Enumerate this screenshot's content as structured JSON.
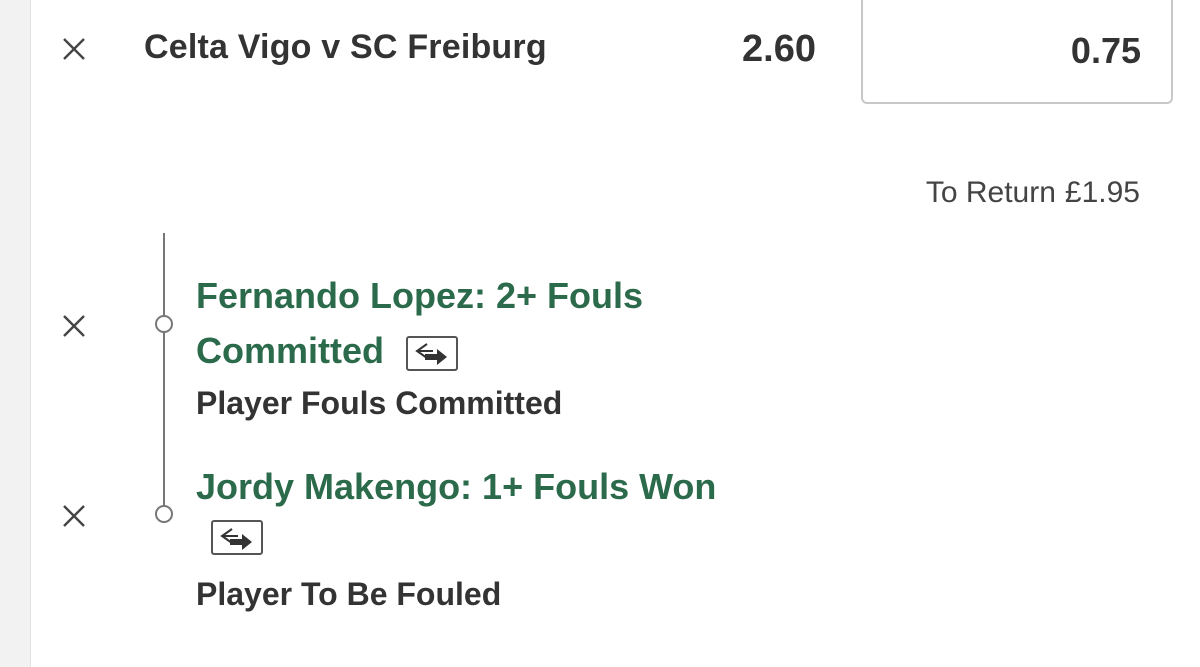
{
  "bet": {
    "event": "Celta Vigo v SC Freiburg",
    "odds": "2.60",
    "stake": "0.75",
    "return_label": "To Return",
    "return_value": "£1.95"
  },
  "selections": [
    {
      "title_line1": "Fernando Lopez: 2+ Fouls",
      "title_line2": "Committed",
      "market": "Player Fouls Committed"
    },
    {
      "title_line1": "Jordy Makengo: 1+ Fouls Won",
      "market": "Player To Be Fouled"
    }
  ],
  "icons": {
    "remove": "close-icon",
    "swap": "swap-arrows-icon"
  },
  "colors": {
    "selection_green": "#2b6a4a",
    "text_dark": "#333333",
    "line_gray": "#777777"
  }
}
